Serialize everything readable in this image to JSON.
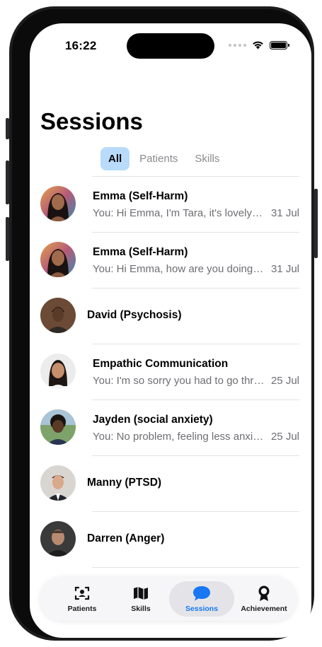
{
  "status_bar": {
    "time": "16:22"
  },
  "page": {
    "title": "Sessions"
  },
  "filters": [
    {
      "label": "All",
      "active": true
    },
    {
      "label": "Patients",
      "active": false
    },
    {
      "label": "Skills",
      "active": false
    }
  ],
  "sessions": [
    {
      "name": "Emma (Self-Harm)",
      "preview": "You: Hi Emma, I'm Tara, it's lovely to meet you",
      "date": "31 Jul"
    },
    {
      "name": "Emma (Self-Harm)",
      "preview": "You: Hi Emma, how are you doing today?",
      "date": "31 Jul"
    },
    {
      "name": "David (Psychosis)",
      "preview": "",
      "date": ""
    },
    {
      "name": "Empathic Communication",
      "preview": "You: I'm so sorry you had to go through that",
      "date": "25 Jul"
    },
    {
      "name": "Jayden (social anxiety)",
      "preview": "You: No problem, feeling less anxious now?",
      "date": "25 Jul"
    },
    {
      "name": "Manny (PTSD)",
      "preview": "",
      "date": ""
    },
    {
      "name": "Darren (Anger)",
      "preview": "",
      "date": ""
    }
  ],
  "tabbar": [
    {
      "label": "Patients",
      "icon": "patients-icon",
      "active": false
    },
    {
      "label": "Skills",
      "icon": "map-icon",
      "active": false
    },
    {
      "label": "Sessions",
      "icon": "chat-bubble-icon",
      "active": true
    },
    {
      "label": "Achievement",
      "icon": "award-ribbon-icon",
      "active": false
    }
  ],
  "colors": {
    "accent": "#1877f2",
    "filter_active_bg": "#b9dbfb"
  }
}
